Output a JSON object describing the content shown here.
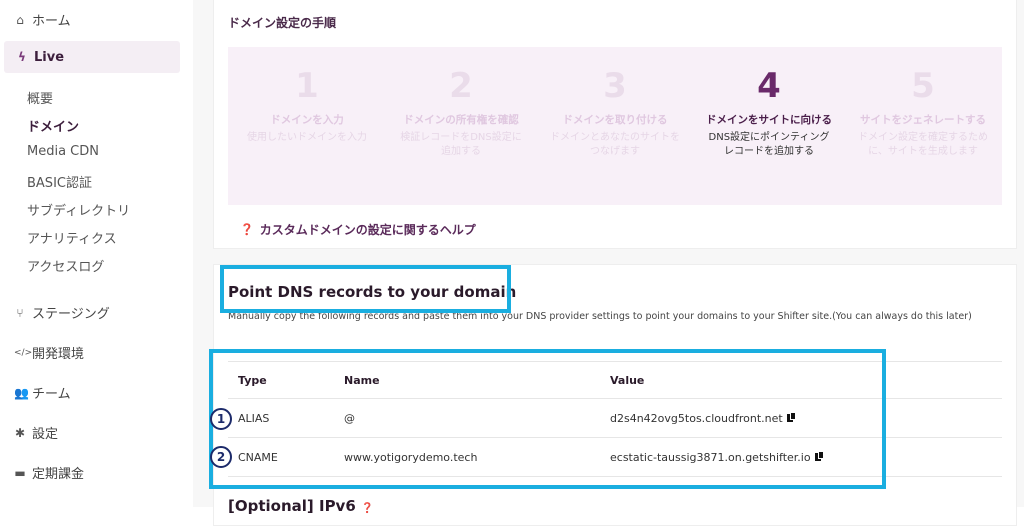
{
  "sidebar": {
    "items": [
      {
        "label": "ホーム",
        "icon": "home-icon"
      },
      {
        "label": "Live",
        "icon": "bolt-icon"
      },
      {
        "label": "ステージング",
        "icon": "branch-icon"
      },
      {
        "label": "開発環境",
        "icon": "code-icon"
      },
      {
        "label": "チーム",
        "icon": "team-icon"
      },
      {
        "label": "設定",
        "icon": "gear-icon"
      },
      {
        "label": "定期課金",
        "icon": "card-icon"
      }
    ],
    "live_subitems": [
      "概要",
      "ドメイン",
      "Media CDN",
      "BASIC認証",
      "サブディレクトリ",
      "アナリティクス",
      "アクセスログ"
    ],
    "current_subitem": "ドメイン"
  },
  "domain_steps": {
    "title": "ドメイン設定の手順",
    "steps": [
      {
        "num": "1",
        "name": "ドメインを入力",
        "desc": "使用したいドメインを入力"
      },
      {
        "num": "2",
        "name": "ドメインの所有権を確認",
        "desc": "検証レコードをDNS設定に追加する"
      },
      {
        "num": "3",
        "name": "ドメインを取り付ける",
        "desc": "ドメインとあなたのサイトをつなげます"
      },
      {
        "num": "4",
        "name": "ドメインをサイトに向ける",
        "desc": "DNS設定にポインティングレコードを追加する"
      },
      {
        "num": "5",
        "name": "サイトをジェネレートする",
        "desc": "ドメイン設定を確定するために、サイトを生成します"
      }
    ],
    "active_step": 4,
    "help_link": "カスタムドメインの設定に関するヘルプ"
  },
  "dns": {
    "title": "Point DNS records to your domain",
    "description": "Manually copy the following records and paste them into your DNS provider settings to point your domains to your Shifter site.(You can always do this later)",
    "columns": [
      "Type",
      "Name",
      "Value"
    ],
    "rows": [
      {
        "marker": "1",
        "type": "ALIAS",
        "name": "@",
        "value": "d2s4n42ovg5tos.cloudfront.net"
      },
      {
        "marker": "2",
        "type": "CNAME",
        "name": "www.yotigorydemo.tech",
        "value": "ecstatic-taussig3871.on.getshifter.io"
      }
    ],
    "ipv6_title": "[Optional] IPv6"
  },
  "colors": {
    "accent": "#6a2a6a",
    "highlight": "#1aaee0",
    "steps_bg": "#f8f0f8"
  }
}
